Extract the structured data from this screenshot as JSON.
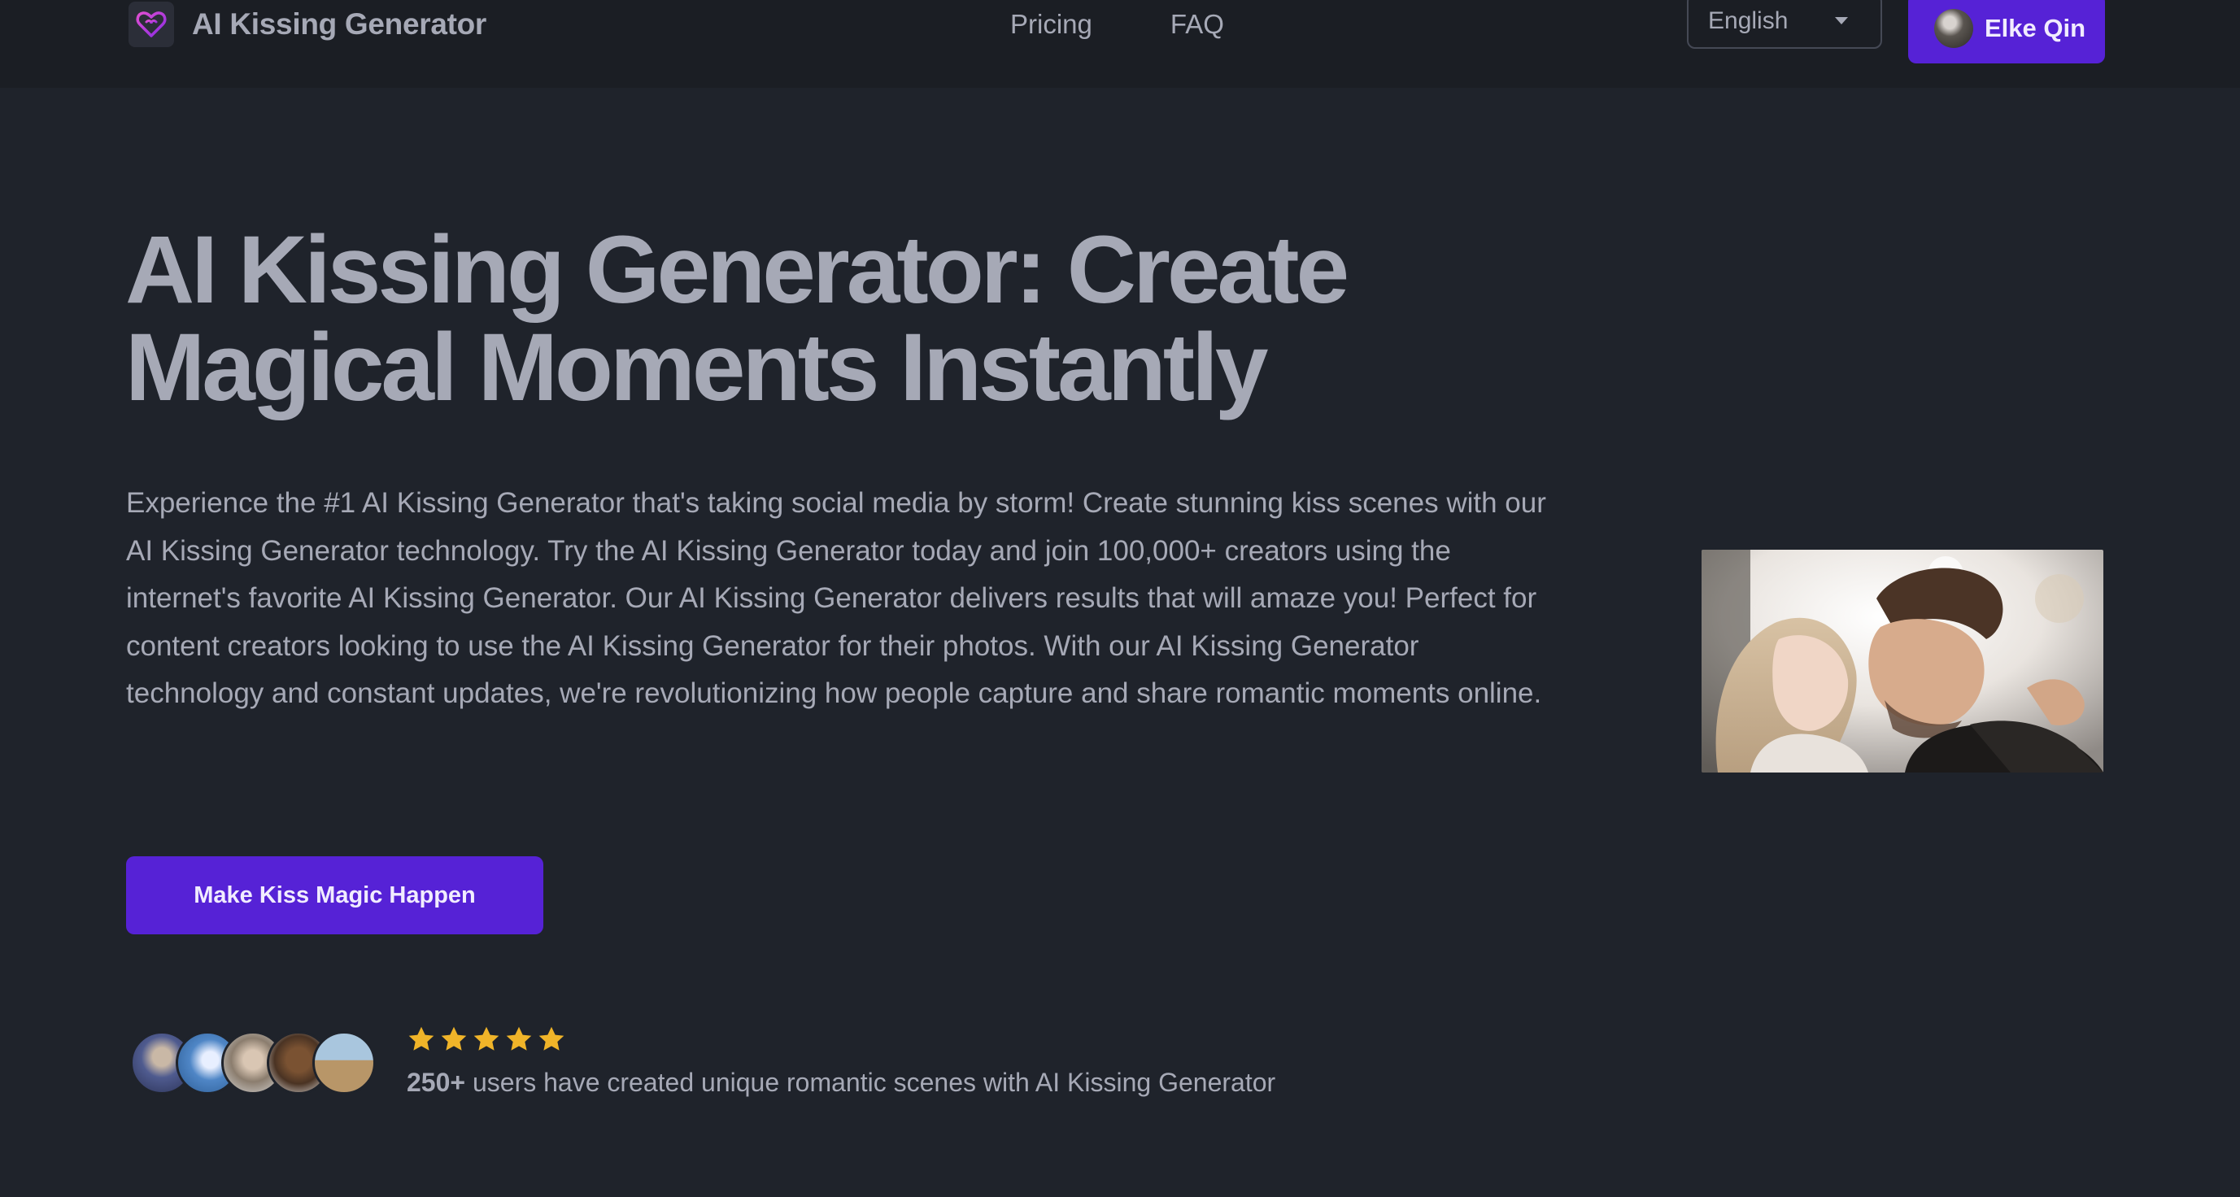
{
  "header": {
    "brand_name": "AI Kissing Generator",
    "logo_icon": "heart-logo-icon",
    "nav": [
      {
        "label": "Pricing"
      },
      {
        "label": "FAQ"
      }
    ],
    "language": {
      "selected": "English",
      "icon": "chevron-down-icon"
    },
    "user": {
      "name": "Elke Qin"
    }
  },
  "hero": {
    "title": "AI Kissing Generator: Create Magical Moments Instantly",
    "description": "Experience the #1 AI Kissing Generator that's taking social media by storm! Create stunning kiss scenes with our AI Kissing Generator technology. Try the AI Kissing Generator today and join 100,000+ creators using the internet's favorite AI Kissing Generator. Our AI Kissing Generator delivers results that will amaze you! Perfect for content creators looking to use the AI Kissing Generator for their photos. With our AI Kissing Generator technology and constant updates, we're revolutionizing how people capture and share romantic moments online.",
    "cta_label": "Make Kiss Magic Happen",
    "social_proof": {
      "rating_stars": 5,
      "count": "250+",
      "text": " users have created unique romantic scenes with AI Kissing Generator"
    }
  },
  "colors": {
    "background": "#1f232b",
    "header_background": "#1b1e24",
    "accent": "#5622d6",
    "text": "#a6a9b6",
    "star": "#f0b429"
  }
}
